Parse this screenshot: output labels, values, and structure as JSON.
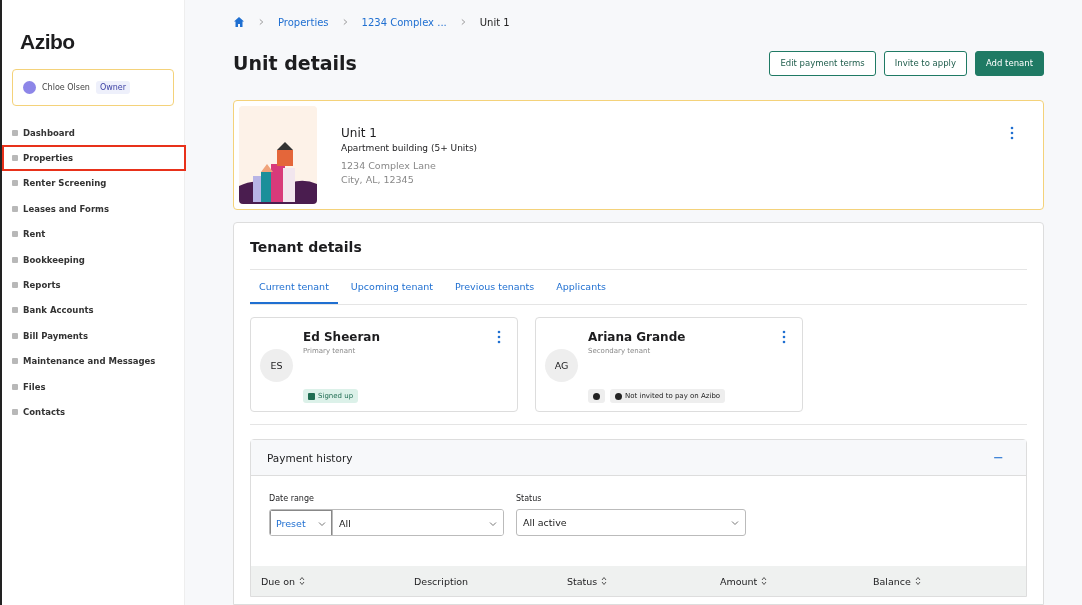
{
  "sidebar": {
    "logo": "Azibo",
    "user": {
      "name": "Chloe Olsen",
      "role": "Owner"
    },
    "items": [
      {
        "label": "Dashboard",
        "selected": false
      },
      {
        "label": "Properties",
        "selected": true
      },
      {
        "label": "Renter Screening",
        "selected": false
      },
      {
        "label": "Leases and Forms",
        "selected": false
      },
      {
        "label": "Rent",
        "selected": false
      },
      {
        "label": "Bookkeeping",
        "selected": false
      },
      {
        "label": "Reports",
        "selected": false
      },
      {
        "label": "Bank Accounts",
        "selected": false
      },
      {
        "label": "Bill Payments",
        "selected": false
      },
      {
        "label": "Maintenance and Messages",
        "selected": false
      },
      {
        "label": "Files",
        "selected": false
      },
      {
        "label": "Contacts",
        "selected": false
      }
    ]
  },
  "breadcrumb": [
    "Properties",
    "1234 Complex ...",
    "Unit 1"
  ],
  "page_title": "Unit details",
  "actions": [
    {
      "label": "Edit payment terms",
      "kind": "outline"
    },
    {
      "label": "Invite to apply",
      "kind": "outline"
    },
    {
      "label": "Add tenant",
      "kind": "primary"
    }
  ],
  "unit": {
    "name": "Unit 1",
    "type": "Apartment building (5+ Units)",
    "address": [
      "1234 Complex Lane",
      "City, AL, 12345"
    ]
  },
  "tenant_details": {
    "title": "Tenant details",
    "tabs": [
      {
        "label": "Current tenant",
        "selected": true
      },
      {
        "label": "Upcoming tenant",
        "selected": false
      },
      {
        "label": "Previous tenants",
        "selected": false
      },
      {
        "label": "Applicants",
        "selected": false
      }
    ],
    "tenants": [
      {
        "initials": "ES",
        "name": "Ed Sheeran",
        "role": "Primary tenant",
        "badges": [
          {
            "kind": "signed",
            "label": "Signed up"
          }
        ]
      },
      {
        "initials": "AG",
        "name": "Ariana Grande",
        "role": "Secondary tenant",
        "badges": [
          {
            "kind": "icon"
          },
          {
            "kind": "status",
            "label": "Not invited to pay on Azibo"
          }
        ]
      }
    ]
  },
  "payment_history": {
    "title": "Payment history",
    "collapse": "−",
    "filters": {
      "date_label": "Date range",
      "preset": "Preset",
      "range": "All",
      "status_label": "Status",
      "status": "All active"
    },
    "columns": [
      {
        "label": "Due on",
        "sortable": true
      },
      {
        "label": "Description",
        "sortable": false
      },
      {
        "label": "Status",
        "sortable": true
      },
      {
        "label": "Amount",
        "sortable": true
      },
      {
        "label": "Balance",
        "sortable": true
      }
    ]
  }
}
